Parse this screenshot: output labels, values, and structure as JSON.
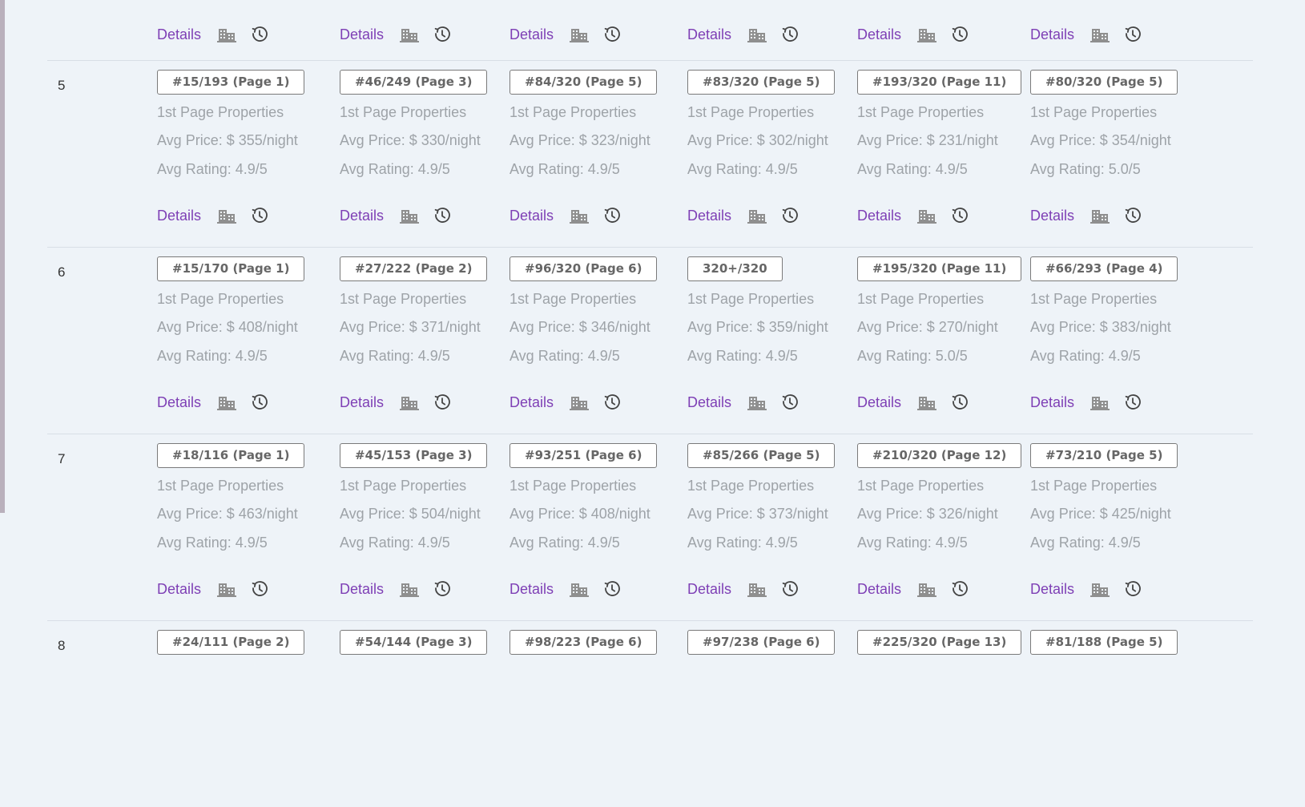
{
  "ui": {
    "details_label": "Details",
    "property_label": "1st Page Properties",
    "price_prefix": "Avg Price: $ ",
    "price_suffix": "/night",
    "rating_prefix": "Avg Rating: ",
    "rating_suffix": "/5"
  },
  "colors": {
    "link": "#7e3fb5",
    "muted_text": "#9ea3a8",
    "badge_border": "#7a7a7a",
    "background": "#eef3f8"
  },
  "icons": {
    "building": "building-icon",
    "history": "history-clock-icon"
  },
  "rows": [
    {
      "num": "5",
      "cells": [
        {
          "rank": "#15/193 (Page 1)",
          "price": "355",
          "rating": "4.9"
        },
        {
          "rank": "#46/249 (Page 3)",
          "price": "330",
          "rating": "4.9"
        },
        {
          "rank": "#84/320 (Page 5)",
          "price": "323",
          "rating": "4.9"
        },
        {
          "rank": "#83/320 (Page 5)",
          "price": "302",
          "rating": "4.9"
        },
        {
          "rank": "#193/320 (Page 11)",
          "price": "231",
          "rating": "4.9"
        },
        {
          "rank": "#80/320 (Page 5)",
          "price": "354",
          "rating": "5.0"
        }
      ]
    },
    {
      "num": "6",
      "cells": [
        {
          "rank": "#15/170 (Page 1)",
          "price": "408",
          "rating": "4.9"
        },
        {
          "rank": "#27/222 (Page 2)",
          "price": "371",
          "rating": "4.9"
        },
        {
          "rank": "#96/320 (Page 6)",
          "price": "346",
          "rating": "4.9"
        },
        {
          "rank": "320+/320",
          "price": "359",
          "rating": "4.9"
        },
        {
          "rank": "#195/320 (Page 11)",
          "price": "270",
          "rating": "5.0"
        },
        {
          "rank": "#66/293 (Page 4)",
          "price": "383",
          "rating": "4.9"
        }
      ]
    },
    {
      "num": "7",
      "cells": [
        {
          "rank": "#18/116 (Page 1)",
          "price": "463",
          "rating": "4.9"
        },
        {
          "rank": "#45/153 (Page 3)",
          "price": "504",
          "rating": "4.9"
        },
        {
          "rank": "#93/251 (Page 6)",
          "price": "408",
          "rating": "4.9"
        },
        {
          "rank": "#85/266 (Page 5)",
          "price": "373",
          "rating": "4.9"
        },
        {
          "rank": "#210/320 (Page 12)",
          "price": "326",
          "rating": "4.9"
        },
        {
          "rank": "#73/210 (Page 5)",
          "price": "425",
          "rating": "4.9"
        }
      ]
    },
    {
      "num": "8",
      "cells": [
        {
          "rank": "#24/111 (Page 2)"
        },
        {
          "rank": "#54/144 (Page 3)"
        },
        {
          "rank": "#98/223 (Page 6)"
        },
        {
          "rank": "#97/238 (Page 6)"
        },
        {
          "rank": "#225/320 (Page 13)"
        },
        {
          "rank": "#81/188 (Page 5)"
        }
      ]
    }
  ]
}
